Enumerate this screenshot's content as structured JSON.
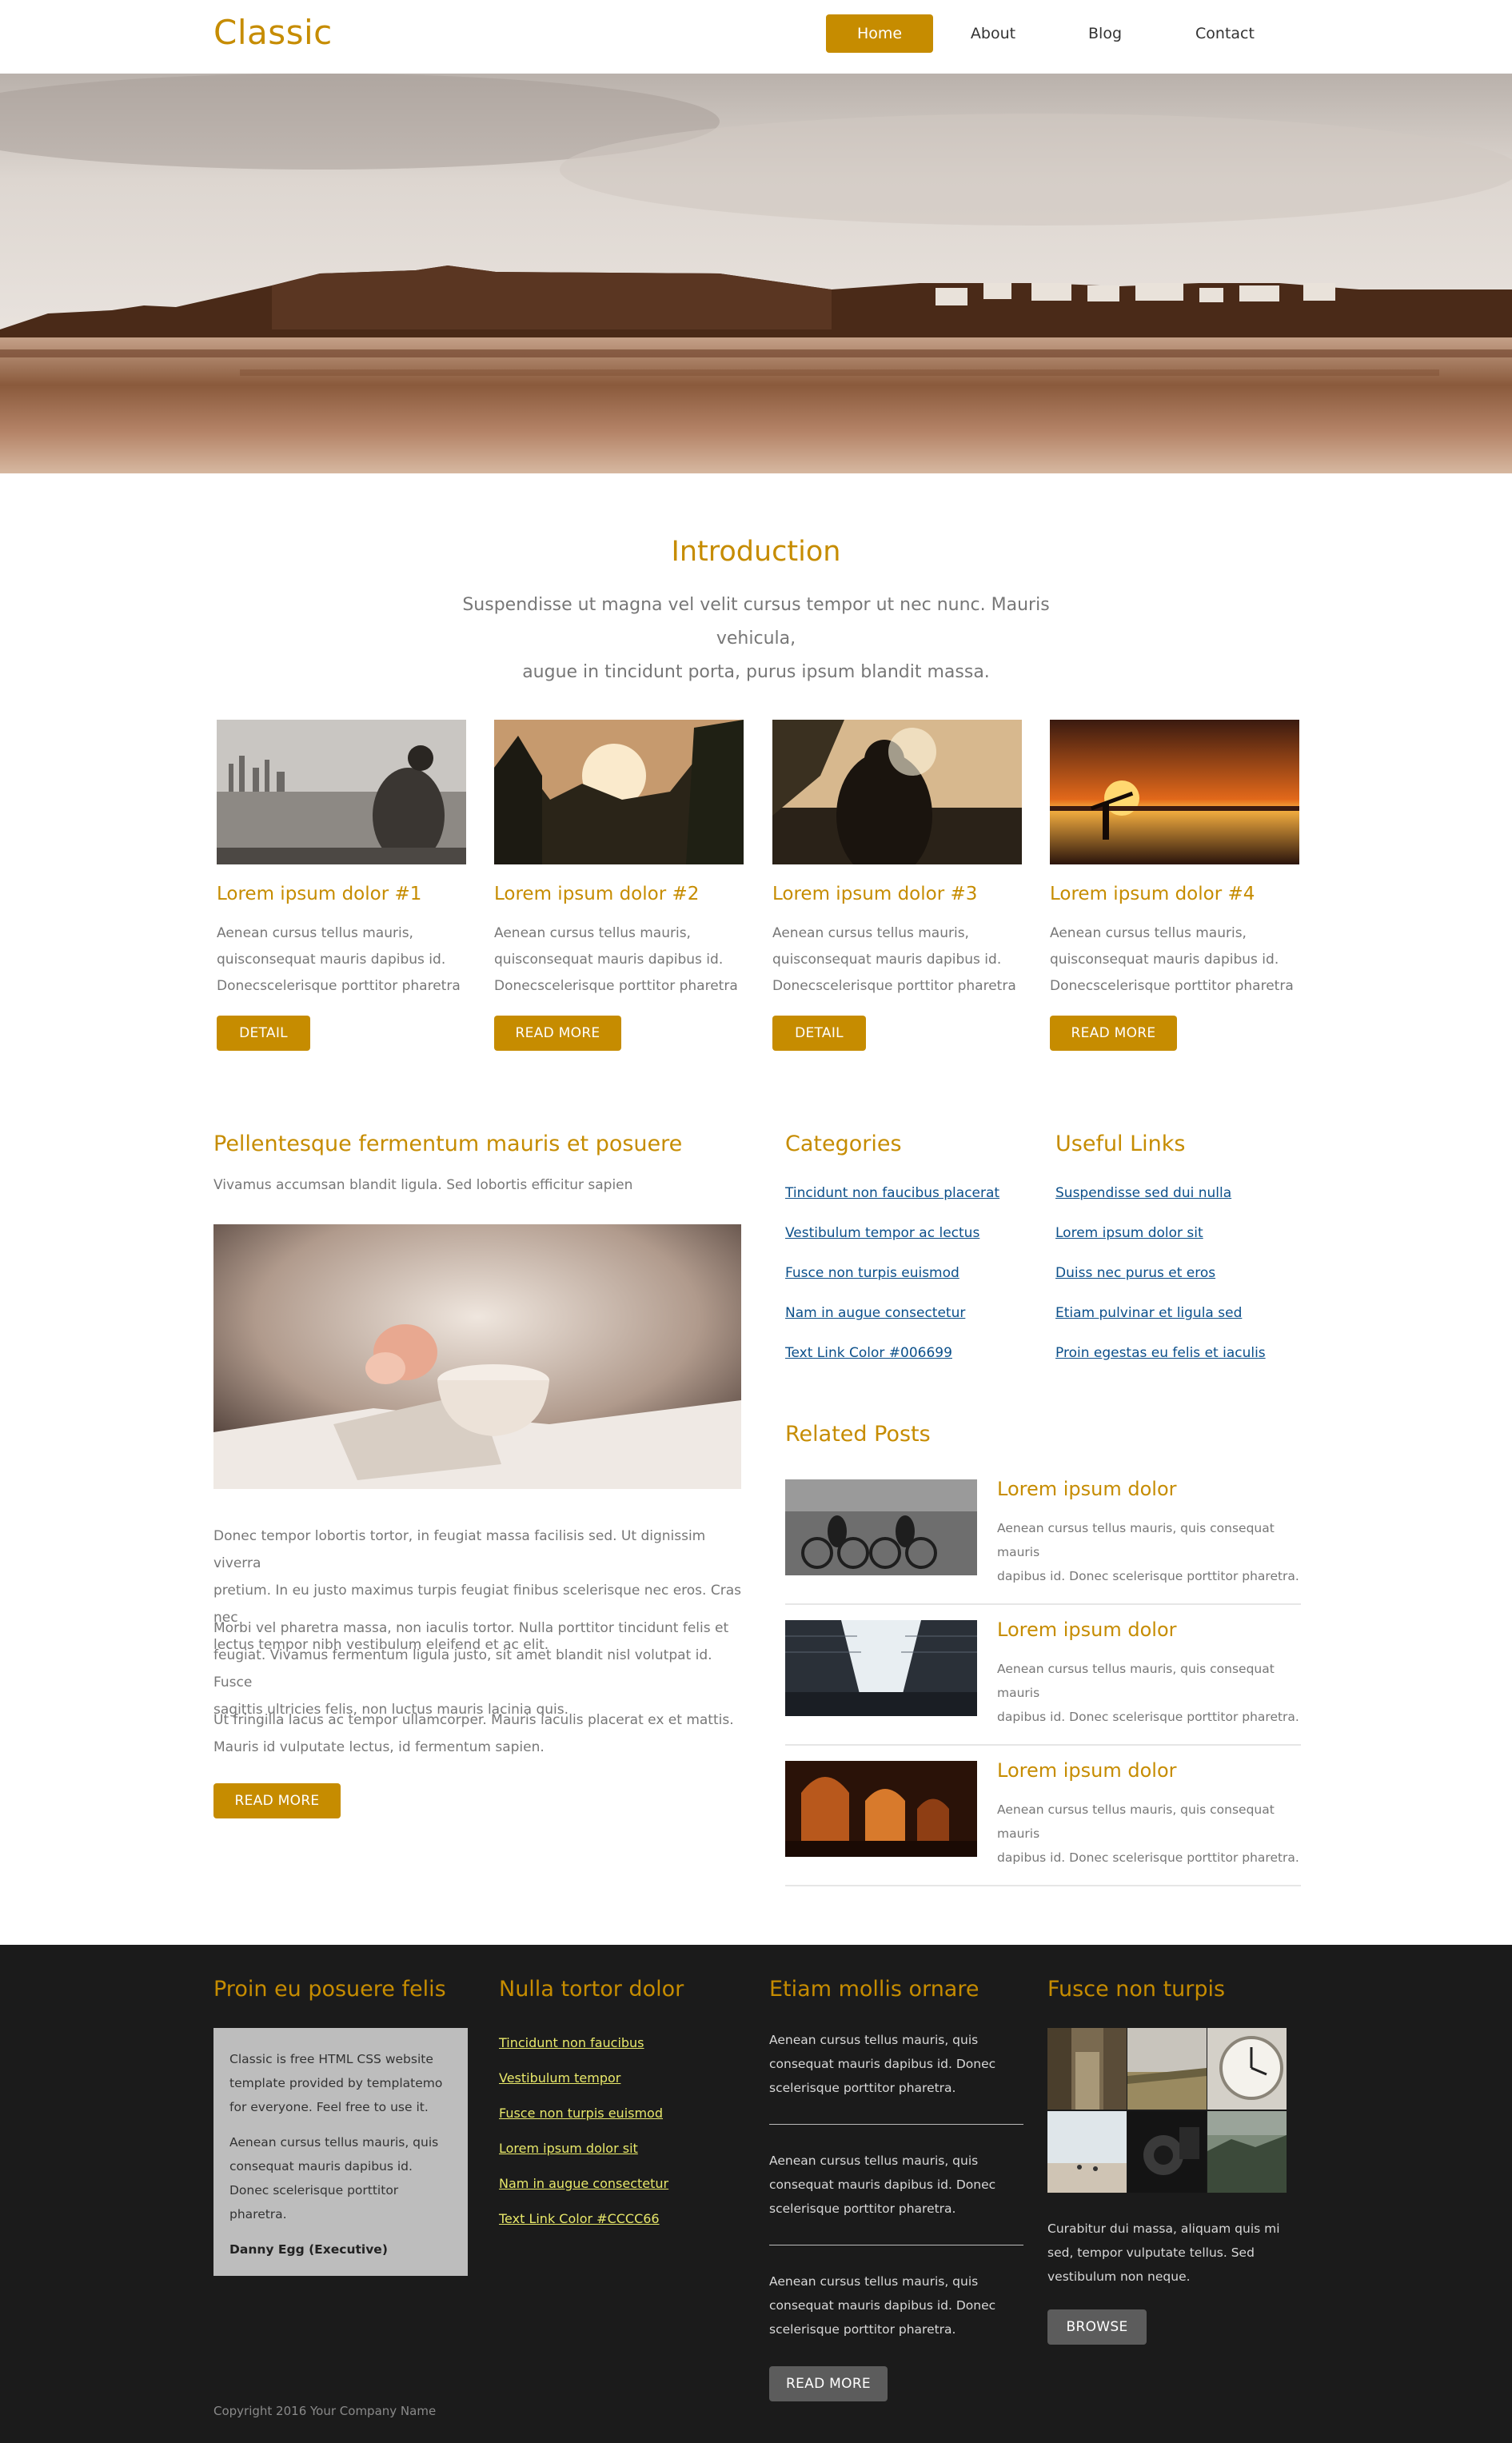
{
  "header": {
    "logo": "Classic",
    "nav": [
      {
        "label": "Home"
      },
      {
        "label": "About"
      },
      {
        "label": "Blog"
      },
      {
        "label": "Contact"
      }
    ]
  },
  "intro": {
    "title": "Introduction",
    "line1": "Suspendisse ut magna vel velit cursus tempor ut nec nunc. Mauris vehicula,",
    "line2": "augue in tincidunt porta, purus ipsum blandit massa."
  },
  "cards": [
    {
      "title": "Lorem ipsum dolor #1",
      "l1": "Aenean cursus tellus mauris,",
      "l2": "quisconsequat mauris dapibus id.",
      "l3": "Donecscelerisque porttitor pharetra",
      "button": "DETAIL"
    },
    {
      "title": "Lorem ipsum dolor #2",
      "l1": "Aenean cursus tellus mauris,",
      "l2": "quisconsequat mauris dapibus id.",
      "l3": "Donecscelerisque porttitor pharetra",
      "button": "READ MORE"
    },
    {
      "title": "Lorem ipsum dolor #3",
      "l1": "Aenean cursus tellus mauris,",
      "l2": "quisconsequat mauris dapibus id.",
      "l3": "Donecscelerisque porttitor pharetra",
      "button": "DETAIL"
    },
    {
      "title": "Lorem ipsum dolor #4",
      "l1": "Aenean cursus tellus mauris,",
      "l2": "quisconsequat mauris dapibus id.",
      "l3": "Donecscelerisque porttitor pharetra",
      "button": "READ MORE"
    }
  ],
  "article": {
    "title": "Pellentesque fermentum mauris et posuere",
    "subtitle": "Vivamus accumsan blandit ligula. Sed lobortis efficitur sapien",
    "p1": [
      "Donec tempor lobortis tortor, in feugiat massa facilisis sed. Ut dignissim viverra",
      "pretium. In eu justo maximus turpis feugiat finibus scelerisque nec eros. Cras nec",
      "lectus tempor nibh vestibulum eleifend et ac elit."
    ],
    "p2": [
      "Morbi vel pharetra massa, non iaculis tortor. Nulla porttitor tincidunt felis et",
      "feugiat. Vivamus fermentum ligula justo, sit amet blandit nisl volutpat id. Fusce",
      "sagittis ultricies felis, non luctus mauris lacinia quis."
    ],
    "p3": [
      "Ut fringilla lacus ac tempor ullamcorper. Mauris iaculis placerat ex et mattis.",
      "Mauris id vulputate lectus, id fermentum sapien."
    ],
    "button": "READ MORE"
  },
  "categories": {
    "title": "Categories",
    "links": [
      "Tincidunt non faucibus placerat",
      "Vestibulum tempor ac lectus",
      "Fusce non turpis euismod",
      "Nam in augue consectetur",
      "Text Link Color #006699"
    ]
  },
  "useful_links": {
    "title": "Useful Links",
    "links": [
      "Suspendisse sed dui nulla",
      "Lorem ipsum dolor sit",
      "Duiss nec purus et eros",
      "Etiam pulvinar et ligula sed",
      "Proin egestas eu felis et iaculis"
    ]
  },
  "related": {
    "title": "Related Posts",
    "posts": [
      {
        "title": "Lorem ipsum dolor",
        "l1": "Aenean cursus tellus mauris, quis consequat mauris",
        "l2": "dapibus id. Donec scelerisque porttitor pharetra."
      },
      {
        "title": "Lorem ipsum dolor",
        "l1": "Aenean cursus tellus mauris, quis consequat mauris",
        "l2": "dapibus id. Donec scelerisque porttitor pharetra."
      },
      {
        "title": "Lorem ipsum dolor",
        "l1": "Aenean cursus tellus mauris, quis consequat mauris",
        "l2": "dapibus id. Donec scelerisque porttitor pharetra."
      }
    ]
  },
  "footer": {
    "col1": {
      "title": "Proin eu posuere felis",
      "p1": "Classic is free HTML CSS website template provided by templatemo for everyone. Feel free to use it.",
      "p2": "Aenean cursus tellus mauris, quis consequat mauris dapibus id. Donec scelerisque porttitor pharetra.",
      "signature": "Danny Egg (Executive)"
    },
    "col2": {
      "title": "Nulla tortor dolor",
      "links": [
        "Tincidunt non faucibus",
        "Vestibulum tempor",
        "Fusce non turpis euismod",
        "Lorem ipsum dolor sit",
        "Nam in augue consectetur",
        "Text Link Color #CCCC66"
      ]
    },
    "col3": {
      "title": "Etiam mollis ornare",
      "items": [
        "Aenean cursus tellus mauris, quis consequat mauris dapibus id. Donec scelerisque porttitor pharetra.",
        "Aenean cursus tellus mauris, quis consequat mauris dapibus id. Donec scelerisque porttitor pharetra.",
        "Aenean cursus tellus mauris, quis consequat mauris dapibus id. Donec scelerisque porttitor pharetra."
      ],
      "button": "READ MORE"
    },
    "col4": {
      "title": "Fusce non turpis",
      "text": "Curabitur dui massa, aliquam quis mi sed, tempor vulputate tellus. Sed vestibulum non neque.",
      "button": "BROWSE"
    },
    "copyright": "Copyright 2016 Your Company Name"
  },
  "colors": {
    "accent": "#c68c00",
    "footer_bg": "#1b1b1b",
    "link": "#0b4f8a",
    "footer_link": "#e8e86a"
  }
}
